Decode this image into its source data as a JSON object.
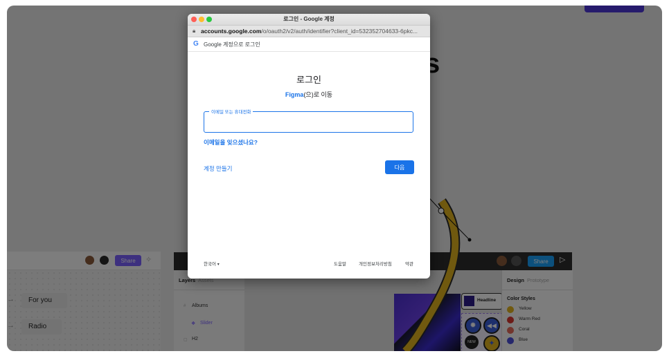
{
  "popup": {
    "window_title": "로그인 - Google 계정",
    "url_domain": "accounts.google.com",
    "url_rest": "/o/oauth2/v2/auth/identifier?client_id=532352704633-6pkc...",
    "google_header": "Google 계정으로 로그인",
    "title": "로그인",
    "subtitle_app": "Figma",
    "subtitle_rest": "(으)로 이동",
    "email_label": "이메일 또는 휴대전화",
    "email_value": "",
    "forgot_email": "이메일을 잊으셨나요?",
    "create_account": "계정 만들기",
    "next_button": "다음",
    "footer": {
      "language": "한국어",
      "help": "도움말",
      "privacy": "개인정보처리방침",
      "terms": "약관"
    }
  },
  "background": {
    "big_letter": "s",
    "left_share": "Share",
    "left_items": [
      "For you",
      "Radio"
    ],
    "right_share": "Share",
    "tabs_left": [
      "Layers",
      "Assets"
    ],
    "tabs_right": [
      "Design",
      "Prototype"
    ],
    "layers": [
      "Albums",
      "Slider",
      "H2"
    ],
    "headline_label": "Headline",
    "badge_new": "NEW",
    "color_styles": {
      "title": "Color Styles",
      "items": [
        {
          "name": "Yellow",
          "color": "#e0b31f"
        },
        {
          "name": "Warm Red",
          "color": "#d9372f"
        },
        {
          "name": "Coral",
          "color": "#e56a5a"
        },
        {
          "name": "Blue",
          "color": "#4b4ed8"
        }
      ]
    }
  },
  "colors": {
    "google_blue": "#1a73e8",
    "figma_purple": "#7b61ff",
    "figma_blue": "#18a0fb"
  }
}
